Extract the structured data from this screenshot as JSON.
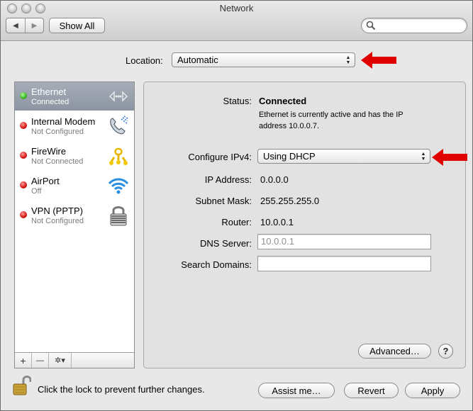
{
  "window": {
    "title": "Network"
  },
  "toolbar": {
    "back_glyph": "◀",
    "forward_glyph": "▶",
    "show_all_label": "Show All",
    "search_placeholder": ""
  },
  "location": {
    "label": "Location:",
    "value": "Automatic"
  },
  "services": [
    {
      "name": "Ethernet",
      "status": "Connected",
      "state": "green",
      "icon": "ethernet-icon",
      "selected": true
    },
    {
      "name": "Internal Modem",
      "status": "Not Configured",
      "state": "red",
      "icon": "phone-icon",
      "selected": false
    },
    {
      "name": "FireWire",
      "status": "Not Connected",
      "state": "red",
      "icon": "firewire-icon",
      "selected": false
    },
    {
      "name": "AirPort",
      "status": "Off",
      "state": "red",
      "icon": "wifi-icon",
      "selected": false
    },
    {
      "name": "VPN (PPTP)",
      "status": "Not Configured",
      "state": "red",
      "icon": "vpn-lock-icon",
      "selected": false
    }
  ],
  "sidebar_toolbar": {
    "add": "+",
    "remove": "—",
    "action": "✲▾"
  },
  "details": {
    "status_label": "Status:",
    "status_value": "Connected",
    "status_desc_1": "Ethernet is currently active and has the IP",
    "status_desc_2": "address 10.0.0.7.",
    "configure_label": "Configure IPv4:",
    "configure_value": "Using DHCP",
    "ip_label": "IP Address:",
    "ip_value": "0.0.0.0",
    "subnet_label": "Subnet Mask:",
    "subnet_value": "255.255.255.0",
    "router_label": "Router:",
    "router_value": "10.0.0.1",
    "dns_label": "DNS Server:",
    "dns_value": "10.0.0.1",
    "search_domains_label": "Search Domains:",
    "search_domains_value": "",
    "advanced_label": "Advanced…",
    "help_label": "?"
  },
  "footer": {
    "lock_text": "Click the lock to prevent further changes.",
    "assist_label": "Assist me…",
    "revert_label": "Revert",
    "apply_label": "Apply"
  },
  "colors": {
    "selection": "#8c95a2",
    "annotation_arrow": "#e00000",
    "status_ok": "#35b51d",
    "status_off": "#d4140f"
  }
}
